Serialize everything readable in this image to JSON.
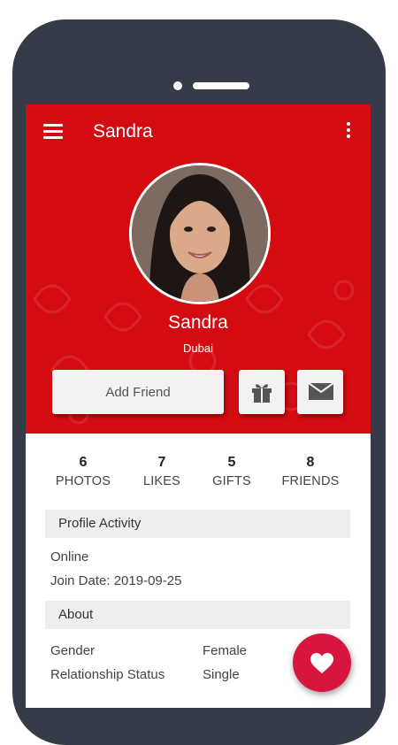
{
  "appbar": {
    "title": "Sandra"
  },
  "profile": {
    "name": "Sandra",
    "location": "Dubai",
    "add_friend_label": "Add Friend"
  },
  "stats": [
    {
      "value": "6",
      "label": "PHOTOS"
    },
    {
      "value": "7",
      "label": "LIKES"
    },
    {
      "value": "5",
      "label": "GIFTS"
    },
    {
      "value": "8",
      "label": "FRIENDS"
    }
  ],
  "activity": {
    "title": "Profile Activity",
    "status": "Online",
    "join_date": "Join Date: 2019-09-25"
  },
  "about": {
    "title": "About",
    "rows": [
      {
        "label": "Gender",
        "value": "Female"
      },
      {
        "label": "Relationship Status",
        "value": "Single"
      }
    ]
  },
  "icons": {
    "menu": "menu-icon",
    "more": "more-vertical-icon",
    "gift": "gift-icon",
    "mail": "mail-icon",
    "fab": "heart-icon"
  },
  "colors": {
    "header": "#d40c12",
    "fab": "#d7163f",
    "frame": "#353b48"
  }
}
